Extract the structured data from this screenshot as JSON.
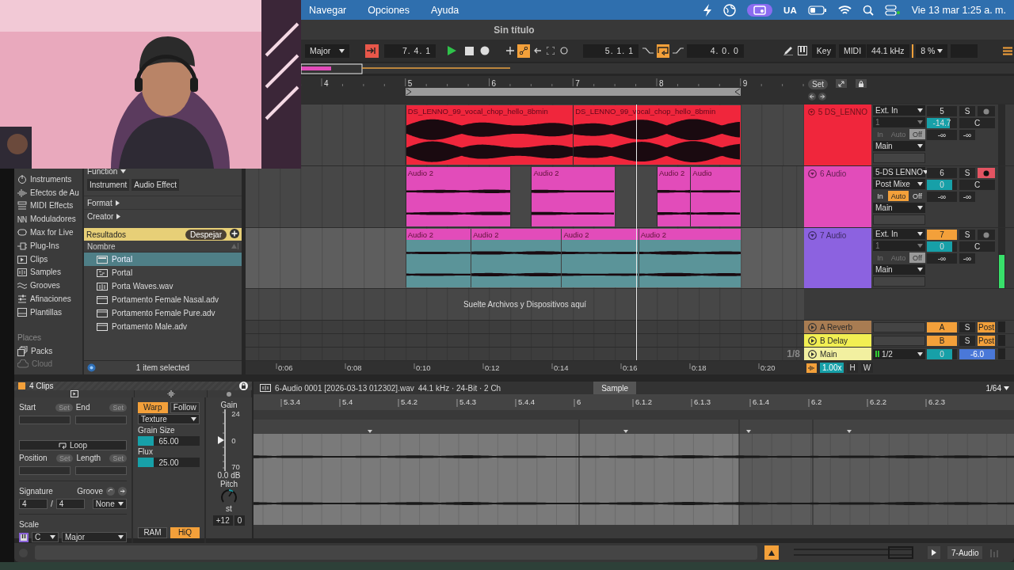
{
  "menu_bar": {
    "items": [
      "Navegar",
      "Opciones",
      "Ayuda"
    ],
    "input_source": "UA",
    "clock": "Vie 13 mar  1:25 a. m."
  },
  "window": {
    "title": "Sin título"
  },
  "transport": {
    "scale": "Major",
    "position": "7. 4. 1",
    "playing": true,
    "automation_arm": true,
    "loop_start": "5. 1. 1",
    "loop_on": true,
    "loop_length": "4. 0. 0",
    "key": "Key",
    "midi": "MIDI",
    "sample_rate": "44.1 kHz",
    "cpu": "8 %"
  },
  "browser": {
    "categories": [
      {
        "label": "Instruments"
      },
      {
        "label": "Efectos de Au"
      },
      {
        "label": "MIDI Effects"
      },
      {
        "label": "Moduladores"
      },
      {
        "label": "Max for Live"
      },
      {
        "label": "Plug-Ins"
      },
      {
        "label": "Clips"
      },
      {
        "label": "Samples"
      },
      {
        "label": "Grooves"
      },
      {
        "label": "Afinaciones"
      },
      {
        "label": "Plantillas"
      }
    ],
    "places_heading": "Places",
    "places": [
      {
        "label": "Packs",
        "disabled": false
      },
      {
        "label": "Cloud",
        "disabled": true
      }
    ],
    "function_filter": "Function",
    "chips": [
      {
        "label": "Instrument"
      },
      {
        "label": "Audio Effect"
      }
    ],
    "format_filter": "Format",
    "creator_filter": "Creator",
    "results": "Resultados",
    "clear": "Despejar",
    "column": "Nombre",
    "items": [
      {
        "label": "Portal",
        "kind": "device",
        "selected": true
      },
      {
        "label": "Portal",
        "kind": "midi",
        "selected": false
      },
      {
        "label": "Porta Waves.wav",
        "kind": "sample",
        "selected": false
      },
      {
        "label": "Portamento Female Nasal.adv",
        "kind": "preset",
        "selected": false
      },
      {
        "label": "Portamento Female Pure.adv",
        "kind": "preset",
        "selected": false
      },
      {
        "label": "Portamento Male.adv",
        "kind": "preset",
        "selected": false
      }
    ],
    "status": "1 item selected"
  },
  "arrangement": {
    "bars": [
      "4",
      "5",
      "6",
      "7",
      "8",
      "9"
    ],
    "set_button": "Set",
    "tracks": [
      {
        "name": "5 DS_LENNO",
        "color": "#f0263c",
        "selected": false,
        "armed": false,
        "input": "Ext. In",
        "channel": "1",
        "monitor": [
          {
            "label": "In",
            "selected": false
          },
          {
            "label": "Auto",
            "selected": false
          },
          {
            "label": "Off",
            "selected": true
          }
        ],
        "output": "Main",
        "number": "5",
        "solo": "S",
        "volume": {
          "reading": "-14.7",
          "level": 0.75
        },
        "pan": "C",
        "peaks": [
          "-∞",
          "-∞"
        ],
        "clips": [
          {
            "label": "DS_LENNO_99_vocal_chop_hello_8bmin",
            "color": "#f0263c",
            "selected": false
          },
          {
            "label": "DS_LENNO_99_vocal_chop_hello_8bmin",
            "color": "#f0263c",
            "selected": false
          }
        ]
      },
      {
        "name": "6 Audio",
        "color": "#e24cba",
        "selected": false,
        "armed": true,
        "input": "5-DS LENNO",
        "channel": "Post Mixe",
        "monitor": [
          {
            "label": "In",
            "selected": false
          },
          {
            "label": "Auto",
            "selected": true
          },
          {
            "label": "Off",
            "selected": false
          }
        ],
        "output": "Main",
        "number": "6",
        "solo": "S",
        "volume": {
          "reading": "0",
          "level": 0.85
        },
        "pan": "C",
        "peaks": [
          "-∞",
          "-∞"
        ],
        "clips": [
          {
            "label": "Audio 2",
            "color": "#e24cba",
            "selected": false
          },
          {
            "label": "Audio 2",
            "color": "#e24cba",
            "selected": false
          },
          {
            "label": "Audio 2",
            "color": "#e24cba",
            "selected": false
          },
          {
            "label": "Audio",
            "color": "#e24cba",
            "selected": false
          }
        ]
      },
      {
        "name": "7 Audio",
        "color": "#8c62e0",
        "selected": true,
        "armed": false,
        "input": "Ext. In",
        "channel": "1",
        "monitor": [
          {
            "label": "In",
            "selected": false
          },
          {
            "label": "Auto",
            "selected": false
          },
          {
            "label": "Off",
            "selected": true
          }
        ],
        "output": "Main",
        "number": "7",
        "solo": "S",
        "volume": {
          "reading": "0",
          "level": 0.85
        },
        "pan": "C",
        "peaks": [
          "-∞",
          "-∞"
        ],
        "meter": {
          "level": 0.55
        },
        "clips": [
          {
            "label": "Audio 2",
            "color": "#e24cba",
            "selected": true
          },
          {
            "label": "Audio 2",
            "color": "#e24cba",
            "selected": true
          },
          {
            "label": "Audio 2",
            "color": "#e24cba",
            "selected": true
          },
          {
            "label": "Audio 2",
            "color": "#e24cba",
            "selected": true
          }
        ]
      }
    ],
    "drop_hint": "Suelte Archivos y Dispositivos aquí",
    "returns": [
      {
        "kind": "return",
        "name": "A Reverb",
        "color": "#a87c52",
        "send": "A",
        "solo": "S",
        "tap": "Post"
      },
      {
        "kind": "return",
        "name": "B Delay",
        "color": "#f2ef52",
        "send": "B",
        "solo": "S",
        "tap": "Post"
      },
      {
        "kind": "main",
        "name": "Main",
        "color": "#f2f0a0",
        "routing": "1/2",
        "volume": {
          "reading": "0",
          "level": 0.85
        },
        "gain": "-6.0"
      }
    ],
    "grid": "1/8",
    "time_ruler": [
      "0:06",
      "0:08",
      "0:10",
      "0:12",
      "0:14",
      "0:16",
      "0:18",
      "0:20"
    ],
    "zoom": "1.00x",
    "view_buttons": [
      "H",
      "W"
    ]
  },
  "clip_view": {
    "title": "4 Clips",
    "file": "6-Audio 0001 [2026-03-13 012302].wav",
    "format": "44.1 kHz · 24-Bit · 2 Ch",
    "tab": "Sample",
    "grid": "1/64",
    "markers": [
      {
        "label": "Start",
        "button": "Set"
      },
      {
        "label": "End",
        "button": "Set"
      }
    ],
    "loop": {
      "label": "Loop"
    },
    "loop_fields": [
      {
        "label": "Position",
        "button": "Set"
      },
      {
        "label": "Length",
        "button": "Set"
      }
    ],
    "signature": {
      "label": "Signature",
      "numerator": "4",
      "separator": "/",
      "denominator": "4"
    },
    "groove": {
      "label": "Groove",
      "value": "None"
    },
    "scale": {
      "label": "Scale",
      "root": "C",
      "mode": "Major"
    },
    "warp": {
      "label": "Warp",
      "on": true
    },
    "follow": {
      "label": "Follow",
      "on": false
    },
    "warp_mode": "Texture",
    "params": [
      {
        "label": "Grain Size",
        "reading": "65.00",
        "level": 0.26
      },
      {
        "label": "Flux",
        "reading": "25.00",
        "level": 0.26
      }
    ],
    "ram": {
      "label": "RAM",
      "on": false
    },
    "hiq": {
      "label": "HiQ",
      "on": true
    },
    "gain": {
      "label": "Gain",
      "ticks": [
        "24",
        "0",
        "70"
      ],
      "level": 0.5,
      "reading": "0.0 dB"
    },
    "pitch": {
      "label": "Pitch",
      "unit": "st",
      "coarse": "+12",
      "fine": "0"
    },
    "ruler": [
      "5.3.4",
      "5.4",
      "5.4.2",
      "5.4.3",
      "5.4.4",
      "6",
      "6.1.2",
      "6.1.3",
      "6.1.4",
      "6.2",
      "6.2.2",
      "6.2.3"
    ]
  },
  "status_bar": {
    "selected_track": "7-Audio"
  }
}
